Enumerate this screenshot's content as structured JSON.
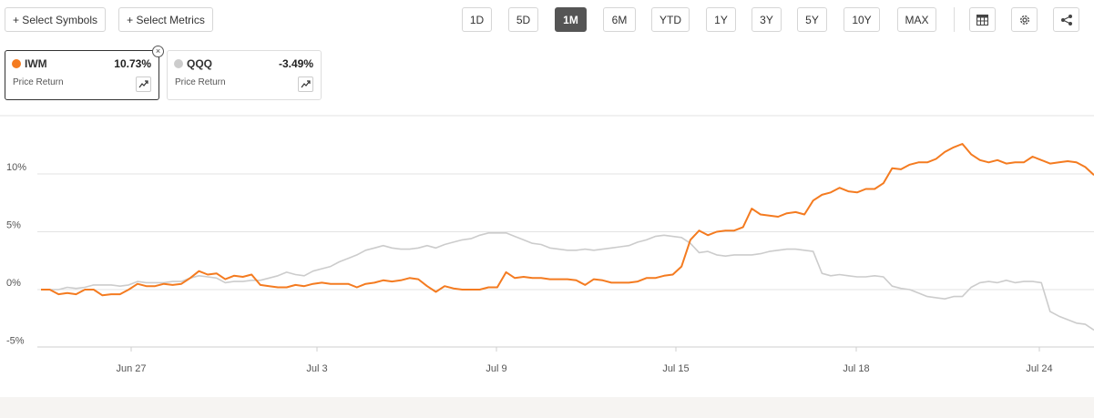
{
  "toolbar": {
    "select_symbols": "+ Select Symbols",
    "select_metrics": "+ Select Metrics",
    "ranges": [
      "1D",
      "5D",
      "1M",
      "6M",
      "YTD",
      "1Y",
      "3Y",
      "5Y",
      "10Y",
      "MAX"
    ],
    "active_range": "1M",
    "icons": [
      "table-icon",
      "gear-icon",
      "share-icon"
    ]
  },
  "cards": [
    {
      "symbol": "IWM",
      "return": "10.73%",
      "metric": "Price Return",
      "color": "#f47b20",
      "active": true
    },
    {
      "symbol": "QQQ",
      "return": "-3.49%",
      "metric": "Price Return",
      "color": "#cccccc",
      "active": false
    }
  ],
  "chart_data": {
    "type": "line",
    "y_ticks": [
      "10%",
      "5%",
      "0%",
      "-5%"
    ],
    "y_tick_values": [
      10,
      5,
      0,
      -5
    ],
    "ylim": [
      -5,
      15
    ],
    "x_ticks": [
      "Jun 27",
      "Jul 3",
      "Jul 9",
      "Jul 15",
      "Jul 18",
      "Jul 24"
    ],
    "grid": true,
    "series": [
      {
        "name": "IWM",
        "color": "#f47b20",
        "x": [
          0,
          1,
          2,
          3,
          4,
          5,
          6,
          7,
          8,
          9,
          10,
          11,
          12,
          13,
          14,
          15,
          16,
          17,
          18,
          19,
          20,
          21,
          22,
          23,
          24,
          25,
          26,
          27,
          28,
          29,
          30,
          31,
          32,
          33,
          34,
          35,
          36,
          37,
          38,
          39,
          40,
          41,
          42,
          43,
          44,
          45,
          46,
          47,
          48,
          49,
          50,
          51,
          52,
          53,
          54,
          55,
          56,
          57,
          58,
          59,
          60,
          61,
          62,
          63,
          64,
          65,
          66,
          67,
          68,
          69,
          70,
          71,
          72,
          73,
          74,
          75,
          76,
          77,
          78,
          79,
          80,
          81,
          82,
          83,
          84,
          85,
          86,
          87,
          88,
          89,
          90,
          91,
          92,
          93,
          94,
          95,
          96,
          97,
          98,
          99,
          100,
          101,
          102,
          103,
          104,
          105,
          106,
          107,
          108,
          109,
          110,
          111,
          112,
          113,
          114,
          115,
          116,
          117,
          118,
          119,
          120
        ],
        "values": [
          0,
          0,
          -0.4,
          -0.3,
          -0.4,
          0,
          0,
          -0.5,
          -0.4,
          -0.4,
          0,
          0.5,
          0.3,
          0.3,
          0.5,
          0.4,
          0.5,
          1.0,
          1.6,
          1.3,
          1.4,
          0.9,
          1.2,
          1.1,
          1.3,
          0.4,
          0.3,
          0.2,
          0.2,
          0.4,
          0.3,
          0.5,
          0.6,
          0.5,
          0.5,
          0.5,
          0.2,
          0.5,
          0.6,
          0.8,
          0.7,
          0.8,
          1.0,
          0.9,
          0.3,
          -0.2,
          0.3,
          0.1,
          0.0,
          0.0,
          0.0,
          0.2,
          0.2,
          1.5,
          1.0,
          1.1,
          1.0,
          1.0,
          0.9,
          0.9,
          0.9,
          0.8,
          0.4,
          0.9,
          0.8,
          0.6,
          0.6,
          0.6,
          0.7,
          1.0,
          1.0,
          1.2,
          1.3,
          2.0,
          4.3,
          5.1,
          4.7,
          5.0,
          5.1,
          5.1,
          5.4,
          7.0,
          6.5,
          6.4,
          6.3,
          6.6,
          6.7,
          6.5,
          7.7,
          8.2,
          8.4,
          8.8,
          8.5,
          8.4,
          8.7,
          8.7,
          9.2,
          10.5,
          10.4,
          10.8,
          11.0,
          11.0,
          11.3,
          11.9,
          12.3,
          12.6,
          11.7,
          11.2,
          11.0,
          11.2,
          10.9,
          11.0,
          11.0,
          11.5,
          11.2,
          10.9,
          11.0,
          11.1,
          11.0,
          10.6,
          9.9
        ]
      },
      {
        "name": "QQQ",
        "color": "#cccccc",
        "x": [
          0,
          1,
          2,
          3,
          4,
          5,
          6,
          7,
          8,
          9,
          10,
          11,
          12,
          13,
          14,
          15,
          16,
          17,
          18,
          19,
          20,
          21,
          22,
          23,
          24,
          25,
          26,
          27,
          28,
          29,
          30,
          31,
          32,
          33,
          34,
          35,
          36,
          37,
          38,
          39,
          40,
          41,
          42,
          43,
          44,
          45,
          46,
          47,
          48,
          49,
          50,
          51,
          52,
          53,
          54,
          55,
          56,
          57,
          58,
          59,
          60,
          61,
          62,
          63,
          64,
          65,
          66,
          67,
          68,
          69,
          70,
          71,
          72,
          73,
          74,
          75,
          76,
          77,
          78,
          79,
          80,
          81,
          82,
          83,
          84,
          85,
          86,
          87,
          88,
          89,
          90,
          91,
          92,
          93,
          94,
          95,
          96,
          97,
          98,
          99,
          100,
          101,
          102,
          103,
          104,
          105,
          106,
          107,
          108,
          109,
          110,
          111,
          112,
          113,
          114,
          115,
          116,
          117,
          118,
          119,
          120
        ],
        "values": [
          0,
          0,
          0,
          0.2,
          0.1,
          0.2,
          0.4,
          0.4,
          0.4,
          0.3,
          0.4,
          0.7,
          0.6,
          0.6,
          0.6,
          0.7,
          0.7,
          1.0,
          1.2,
          1.1,
          1.0,
          0.6,
          0.7,
          0.7,
          0.8,
          0.8,
          1.0,
          1.2,
          1.5,
          1.3,
          1.2,
          1.6,
          1.8,
          2.0,
          2.4,
          2.7,
          3.0,
          3.4,
          3.6,
          3.8,
          3.6,
          3.5,
          3.5,
          3.6,
          3.8,
          3.6,
          3.9,
          4.1,
          4.3,
          4.4,
          4.7,
          4.9,
          4.9,
          4.9,
          4.6,
          4.3,
          4.0,
          3.9,
          3.6,
          3.5,
          3.4,
          3.4,
          3.5,
          3.4,
          3.5,
          3.6,
          3.7,
          3.8,
          4.1,
          4.3,
          4.6,
          4.7,
          4.6,
          4.5,
          4.0,
          3.2,
          3.3,
          3.0,
          2.9,
          3.0,
          3.0,
          3.0,
          3.1,
          3.3,
          3.4,
          3.5,
          3.5,
          3.4,
          3.3,
          1.4,
          1.2,
          1.3,
          1.2,
          1.1,
          1.1,
          1.2,
          1.1,
          0.3,
          0.1,
          0.0,
          -0.3,
          -0.6,
          -0.7,
          -0.8,
          -0.6,
          -0.6,
          0.2,
          0.6,
          0.7,
          0.6,
          0.8,
          0.6,
          0.7,
          0.7,
          0.6,
          -1.9,
          -2.3,
          -2.6,
          -2.9,
          -3.0,
          -3.5
        ]
      }
    ]
  }
}
